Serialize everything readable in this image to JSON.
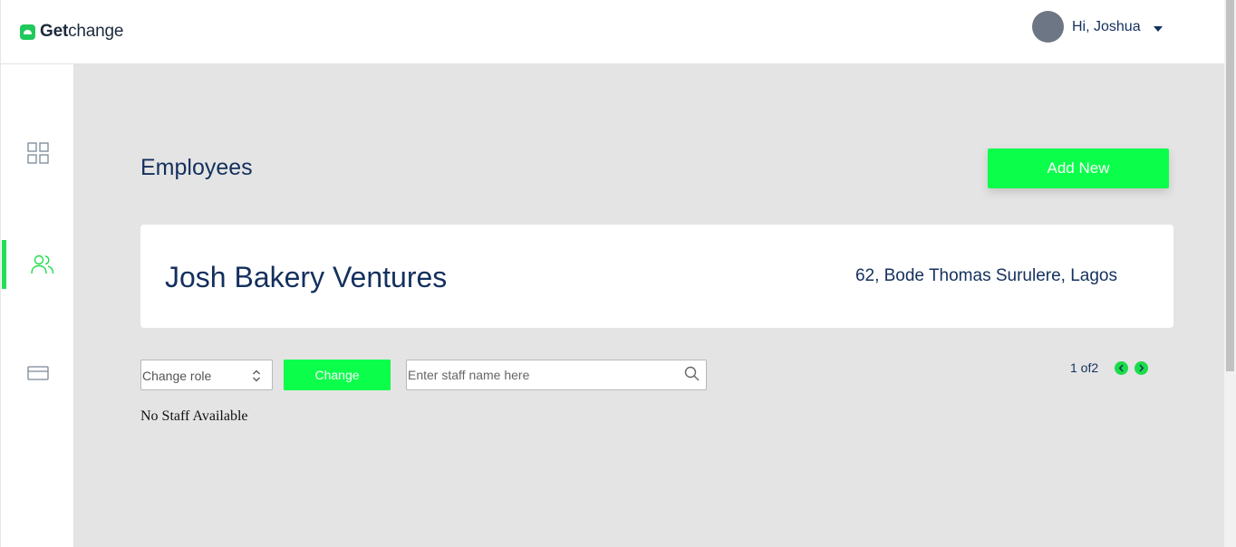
{
  "header": {
    "logo_bold": "Get",
    "logo_light": "change",
    "greeting": "Hi, Joshua"
  },
  "sidebar": {
    "items": [
      {
        "name": "dashboard",
        "icon": "grid-icon",
        "active": false
      },
      {
        "name": "employees",
        "icon": "users-icon",
        "active": true
      },
      {
        "name": "payments",
        "icon": "card-icon",
        "active": false
      }
    ],
    "active_color": "#22e059"
  },
  "main": {
    "title": "Employees",
    "add_button": "Add New",
    "business": {
      "name": "Josh Bakery Ventures",
      "address": "62, Bode Thomas Surulere, Lagos"
    },
    "toolbar": {
      "role_select": "Change role",
      "change_button": "Change",
      "search_placeholder": "Enter staff name here"
    },
    "pagination": {
      "label": "1 of2"
    },
    "empty_message": "No Staff Available"
  },
  "colors": {
    "accent": "#0bff4a",
    "text": "#14305e",
    "background": "#e4e4e4"
  }
}
